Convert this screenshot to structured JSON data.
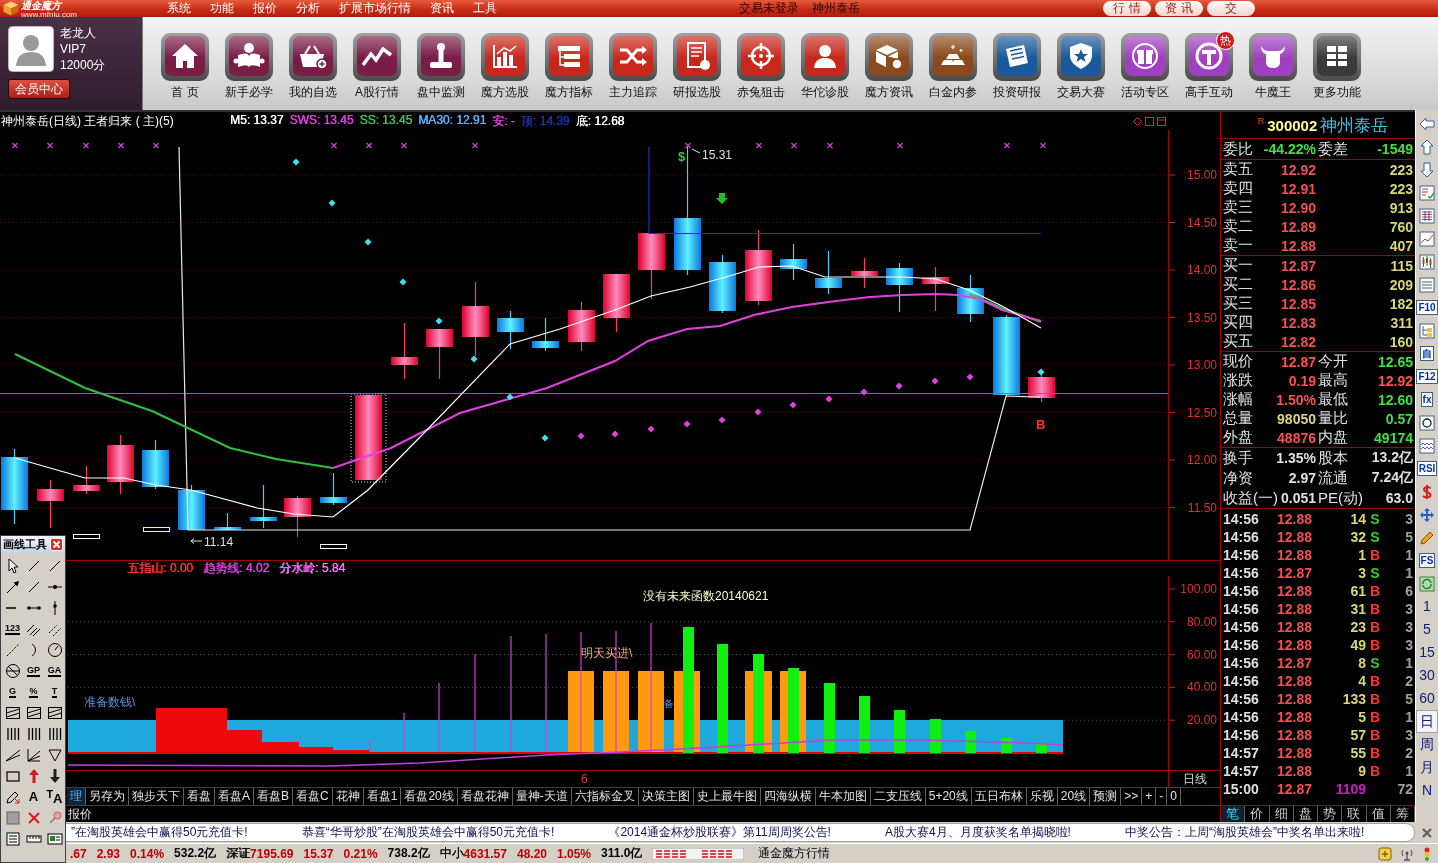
{
  "menu_bar": {
    "logo": "通金魔方",
    "url": "www.mfniu.com",
    "items": [
      "系统",
      "功能",
      "报价",
      "分析",
      "扩展市场行情",
      "资讯",
      "工具"
    ],
    "login_status": "交易未登录",
    "stock": "神州泰岳",
    "tabs": [
      {
        "label": "行 情",
        "selected": false
      },
      {
        "label": "资 讯",
        "selected": false
      },
      {
        "label": "交",
        "selected": false
      }
    ]
  },
  "user": {
    "name": "老龙人",
    "level": "VIP7",
    "points": "12000分",
    "button": "会员中心"
  },
  "tools": [
    {
      "label": "首 页",
      "color": "#7a1c48"
    },
    {
      "label": "新手必学",
      "color": "#7a1c48"
    },
    {
      "label": "我的自选",
      "color": "#7a1c48"
    },
    {
      "label": "A股行情",
      "color": "#7a1c48"
    },
    {
      "label": "盘中监测",
      "color": "#7a1c48"
    },
    {
      "label": "魔方选股",
      "color": "#c8281c"
    },
    {
      "label": "魔方指标",
      "color": "#c8281c"
    },
    {
      "label": "主力追踪",
      "color": "#c8281c"
    },
    {
      "label": "研报选股",
      "color": "#c8281c"
    },
    {
      "label": "赤兔狙击",
      "color": "#c8281c"
    },
    {
      "label": "华佗诊股",
      "color": "#c8281c"
    },
    {
      "label": "魔方资讯",
      "color": "#8a4a1c"
    },
    {
      "label": "白金内参",
      "color": "#8a4a1c"
    },
    {
      "label": "投资研报",
      "color": "#1a5a9a"
    },
    {
      "label": "交易大赛",
      "color": "#1a5a9a"
    },
    {
      "label": "活动专区",
      "color": "#a040c0"
    },
    {
      "label": "高手互动",
      "color": "#a040c0",
      "badge": "热"
    },
    {
      "label": "牛魔王",
      "color": "#a040c0"
    },
    {
      "label": "更多功能",
      "color": "#3a3a3a"
    }
  ],
  "chart": {
    "title": "神州泰岳(日线) 王者归来 ( 主)(5)",
    "legend": [
      {
        "label": "M5: 13.37",
        "color": "#ffffff"
      },
      {
        "label": "SWS: 13.45",
        "color": "#e040e0"
      },
      {
        "label": "SS: 13.45",
        "color": "#40c060"
      },
      {
        "label": "MA30: 12.91",
        "color": "#60b0ff"
      },
      {
        "label": "安: -",
        "color": "#e040e0"
      },
      {
        "label": "顶: 14.39",
        "color": "#2030b0"
      },
      {
        "label": "底: 12.68",
        "color": "#ffffff"
      }
    ],
    "price_axis": [
      "15.00",
      "14.50",
      "14.00",
      "13.50",
      "13.00",
      "12.50",
      "12.00",
      "11.50"
    ],
    "high_mark": "$",
    "high_label": "15.31",
    "low_label": "11.14",
    "signal": "B"
  },
  "indicator": {
    "legend": [
      {
        "label": "五指山: 0.00",
        "color": "#ff3030"
      },
      {
        "label": "趋势线: 4.02",
        "color": "#e040e0"
      },
      {
        "label": "分水岭: 5.84",
        "color": "#ff70ff"
      }
    ],
    "note": "没有未来函数20140621",
    "buy_label": "明天买进\\",
    "ready_label": "准备数钱\\",
    "partial_label": "备",
    "axis": [
      "100.00",
      "80.00",
      "60.00",
      "40.00",
      "20.00"
    ]
  },
  "time_axis": {
    "tick": "6",
    "period": "日线"
  },
  "template_tabs": [
    {
      "label": "理",
      "selected": true
    },
    {
      "label": "另存为",
      "selected": false
    },
    {
      "label": "独步天下",
      "selected": false
    },
    {
      "label": "看盘",
      "selected": false
    },
    {
      "label": "看盘A",
      "selected": false
    },
    {
      "label": "看盘B",
      "selected": false
    },
    {
      "label": "看盘C",
      "selected": false
    },
    {
      "label": "花神",
      "selected": false
    },
    {
      "label": "看盘1",
      "selected": false
    },
    {
      "label": "看盘20线",
      "selected": false
    },
    {
      "label": "看盘花神",
      "selected": false
    },
    {
      "label": "量神-天道",
      "selected": false
    },
    {
      "label": "六指标金叉",
      "selected": false
    },
    {
      "label": "决策主图",
      "selected": false
    },
    {
      "label": "史上最牛图",
      "selected": false
    },
    {
      "label": "四海纵横",
      "selected": false
    },
    {
      "label": "牛本加图",
      "selected": false
    },
    {
      "label": "二支压线",
      "selected": false
    },
    {
      "label": "5+20线",
      "selected": false
    },
    {
      "label": "五日布林",
      "selected": false
    },
    {
      "label": "乐视",
      "selected": false
    },
    {
      "label": "20线",
      "selected": false
    },
    {
      "label": "预测",
      "selected": false
    },
    {
      "label": ">>",
      "selected": false
    },
    {
      "label": "+",
      "selected": false
    },
    {
      "label": "-",
      "selected": false
    },
    {
      "label": "0",
      "selected": false
    }
  ],
  "report_tab": "报价",
  "quote": {
    "tag": "R",
    "code": "300002",
    "name": "神州泰岳",
    "ratio": [
      {
        "label": "委比",
        "value": "-44.22%"
      },
      {
        "label": "委差",
        "value": "-1549"
      }
    ],
    "asks": [
      {
        "label": "卖五",
        "price": "12.92",
        "volume": "223"
      },
      {
        "label": "卖四",
        "price": "12.91",
        "volume": "223"
      },
      {
        "label": "卖三",
        "price": "12.90",
        "volume": "913"
      },
      {
        "label": "卖二",
        "price": "12.89",
        "volume": "760"
      },
      {
        "label": "卖一",
        "price": "12.88",
        "volume": "407"
      }
    ],
    "bids": [
      {
        "label": "买一",
        "price": "12.87",
        "volume": "115"
      },
      {
        "label": "买二",
        "price": "12.86",
        "volume": "209"
      },
      {
        "label": "买三",
        "price": "12.85",
        "volume": "182"
      },
      {
        "label": "买四",
        "price": "12.83",
        "volume": "311"
      },
      {
        "label": "买五",
        "price": "12.82",
        "volume": "160"
      }
    ],
    "stats": [
      {
        "label": "现价",
        "value": "12.87",
        "color": "#ff5050"
      },
      {
        "label": "今开",
        "value": "12.65",
        "color": "#40e040"
      },
      {
        "label": "涨跌",
        "value": "0.19",
        "color": "#ff5050"
      },
      {
        "label": "最高",
        "value": "12.92",
        "color": "#ff5050"
      },
      {
        "label": "涨幅",
        "value": "1.50%",
        "color": "#ff5050"
      },
      {
        "label": "最低",
        "value": "12.60",
        "color": "#40e040"
      },
      {
        "label": "总量",
        "value": "98050",
        "color": "#d8d878"
      },
      {
        "label": "量比",
        "value": "0.57",
        "color": "#40e040"
      },
      {
        "label": "外盘",
        "value": "48876",
        "color": "#ff5050"
      },
      {
        "label": "内盘",
        "value": "49174",
        "color": "#40e040"
      }
    ],
    "fundamentals": [
      {
        "label": "换手",
        "value": "1.35%"
      },
      {
        "label": "股本",
        "value": "13.2亿"
      },
      {
        "label": "净资",
        "value": "2.97"
      },
      {
        "label": "流通",
        "value": "7.24亿"
      },
      {
        "label": "收益(一)",
        "value": "0.051"
      },
      {
        "label": "PE(动)",
        "value": "63.0"
      }
    ]
  },
  "ticks": [
    {
      "time": "14:56",
      "price": "12.88",
      "volume": "14",
      "side": "S",
      "kind": "sell",
      "count": "3"
    },
    {
      "time": "14:56",
      "price": "12.88",
      "volume": "32",
      "side": "S",
      "kind": "sell",
      "count": "5"
    },
    {
      "time": "14:56",
      "price": "12.88",
      "volume": "1",
      "side": "B",
      "kind": "buy",
      "count": "1"
    },
    {
      "time": "14:56",
      "price": "12.87",
      "volume": "3",
      "side": "S",
      "kind": "sell",
      "count": "1"
    },
    {
      "time": "14:56",
      "price": "12.88",
      "volume": "61",
      "side": "B",
      "kind": "buy",
      "count": "6"
    },
    {
      "time": "14:56",
      "price": "12.88",
      "volume": "31",
      "side": "B",
      "kind": "buy",
      "count": "3"
    },
    {
      "time": "14:56",
      "price": "12.88",
      "volume": "23",
      "side": "B",
      "kind": "buy",
      "count": "3"
    },
    {
      "time": "14:56",
      "price": "12.88",
      "volume": "49",
      "side": "B",
      "kind": "buy",
      "count": "3"
    },
    {
      "time": "14:56",
      "price": "12.87",
      "volume": "8",
      "side": "S",
      "kind": "sell",
      "count": "1"
    },
    {
      "time": "14:56",
      "price": "12.88",
      "volume": "4",
      "side": "B",
      "kind": "buy",
      "count": "2"
    },
    {
      "time": "14:56",
      "price": "12.88",
      "volume": "133",
      "side": "B",
      "kind": "buy",
      "count": "5"
    },
    {
      "time": "14:56",
      "price": "12.88",
      "volume": "5",
      "side": "B",
      "kind": "buy",
      "count": "1"
    },
    {
      "time": "14:56",
      "price": "12.88",
      "volume": "57",
      "side": "B",
      "kind": "buy",
      "count": "3"
    },
    {
      "time": "14:57",
      "price": "12.88",
      "volume": "55",
      "side": "B",
      "kind": "buy",
      "count": "2"
    },
    {
      "time": "14:57",
      "price": "12.88",
      "volume": "9",
      "side": "B",
      "kind": "buy",
      "count": "1"
    },
    {
      "time": "15:00",
      "price": "12.87",
      "volume": "1109",
      "kind": "closing",
      "count": "72"
    }
  ],
  "detail_tabs": [
    {
      "label": "笔",
      "selected": true
    },
    {
      "label": "价",
      "selected": false
    },
    {
      "label": "细",
      "selected": false
    },
    {
      "label": "盘",
      "selected": false
    },
    {
      "label": "势",
      "selected": false
    },
    {
      "label": "联",
      "selected": false
    },
    {
      "label": "值",
      "selected": false
    },
    {
      "label": "筹",
      "selected": false
    }
  ],
  "side_toolbar": {
    "labels": [
      "F10",
      "自",
      "F12",
      "fx",
      "RSI",
      "FS"
    ],
    "periods": [
      {
        "label": "1",
        "selected": false
      },
      {
        "label": "5",
        "selected": false
      },
      {
        "label": "15",
        "selected": false
      },
      {
        "label": "30",
        "selected": false
      },
      {
        "label": "60",
        "selected": false
      },
      {
        "label": "日",
        "selected": true
      },
      {
        "label": "周",
        "selected": false
      },
      {
        "label": "月",
        "selected": false
      },
      {
        "label": "N",
        "selected": false
      }
    ]
  },
  "drawing_tools": {
    "title": "画线工具",
    "text_tools": [
      {
        "label": "123",
        "kind": "tagged"
      },
      {
        "label": "GP",
        "kind": "tagged"
      },
      {
        "label": "GA",
        "kind": "tagged"
      },
      {
        "label": "G",
        "kind": "tagged"
      },
      {
        "label": "%",
        "kind": "tagged"
      },
      {
        "label": "T",
        "kind": "tagged"
      },
      {
        "label": "A",
        "kind": "letter"
      },
      {
        "label": "$^{T}$A",
        "kind": "letter"
      }
    ]
  },
  "ticker": [
    "”在淘股英雄会中赢得50元充值卡!",
    "恭喜“华哥炒股”在淘股英雄会中赢得50元充值卡!",
    "《2014通金杯炒股联赛》第11周周奖公告!",
    "A股大赛4月、月度获奖名单揭晓啦!",
    "中奖公告：上周“淘股英雄会”中奖名单出来啦!"
  ],
  "status_bar": {
    "indices": [
      {
        "values": [
          {
            "text": ".67",
            "color": "#c00000"
          },
          {
            "text": "2.93",
            "color": "#c00000"
          },
          {
            "text": "0.14%",
            "color": "#c00000"
          },
          {
            "text": "532.2亿",
            "color": "#000000"
          }
        ]
      },
      {
        "label": "深证",
        "values": [
          {
            "text": "7195.69",
            "color": "#c00000"
          },
          {
            "text": "15.37",
            "color": "#c00000"
          },
          {
            "text": "0.21%",
            "color": "#c00000"
          },
          {
            "text": "738.2亿",
            "color": "#000000"
          }
        ]
      },
      {
        "label": "中小",
        "values": [
          {
            "text": "4631.57",
            "color": "#c00000"
          },
          {
            "text": "48.20",
            "color": "#c00000"
          },
          {
            "text": "1.05%",
            "color": "#c00000"
          },
          {
            "text": "311.0亿",
            "color": "#000000"
          }
        ]
      }
    ],
    "app_label": "通金魔方行情"
  }
}
